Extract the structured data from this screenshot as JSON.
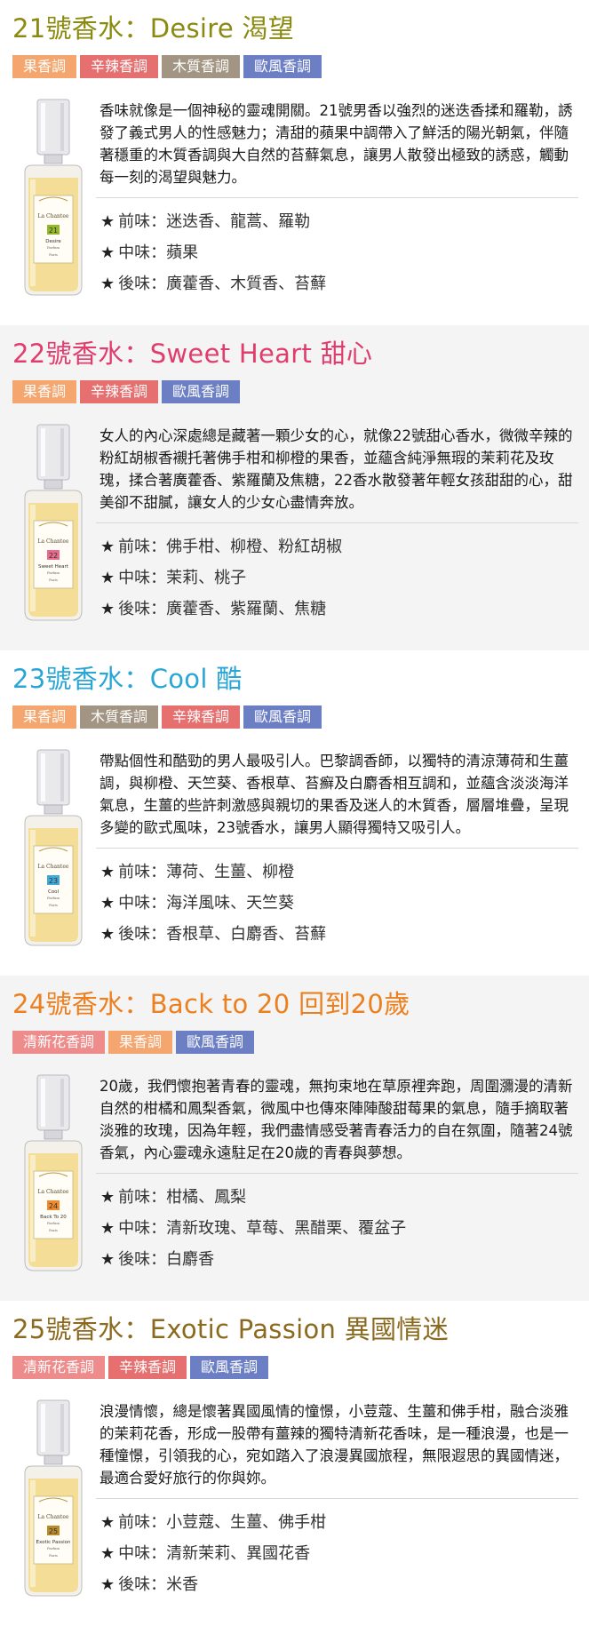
{
  "colors": {
    "fruit": "#f5a66f",
    "spicy": "#e66f6f",
    "woody": "#a39583",
    "oriental": "#6c7fc4",
    "floral": "#ee8c8c"
  },
  "perfumes": [
    {
      "title": "21號香水：Desire 渴望",
      "title_color": "#8b8a10",
      "tags": [
        {
          "label": "果香調",
          "color": "#f5a66f"
        },
        {
          "label": "辛辣香調",
          "color": "#e66f6f"
        },
        {
          "label": "木質香調",
          "color": "#a39583"
        },
        {
          "label": "歐風香調",
          "color": "#6c7fc4"
        }
      ],
      "bottle": {
        "brand": "La Chantee",
        "number": "21",
        "name": "Desire",
        "sub": "Parfum",
        "city": "Paris",
        "num_color": "#93b82a"
      },
      "description": "香味就像是一個神秘的靈魂開關。21號男香以強烈的迷迭香揉和羅勒，誘發了義式男人的性感魅力；清甜的蘋果中調帶入了鮮活的陽光朝氣，伴隨著穩重的木質香調與大自然的苔蘚氣息，讓男人散發出極致的誘惑，觸動每一刻的渴望與魅力。",
      "notes": [
        "前味：迷迭香、龍蒿、羅勒",
        "中味：蘋果",
        "後味：廣藿香、木質香、苔蘚"
      ]
    },
    {
      "title": "22號香水：Sweet Heart 甜心",
      "title_color": "#e03d6e",
      "tags": [
        {
          "label": "果香調",
          "color": "#f5a66f"
        },
        {
          "label": "辛辣香調",
          "color": "#e66f6f"
        },
        {
          "label": "歐風香調",
          "color": "#6c7fc4"
        }
      ],
      "bottle": {
        "brand": "La Chantee",
        "number": "22",
        "name": "Sweet Heart",
        "sub": "Parfum",
        "city": "Paris",
        "num_color": "#e86a8c"
      },
      "description": "女人的內心深處總是藏著一顆少女的心，就像22號甜心香水，微微辛辣的粉紅胡椒香襯托著佛手柑和柳橙的果香，並蘊含純淨無瑕的茉莉花及玫瑰，揉合著廣藿香、紫羅蘭及焦糖，22香水散發著年輕女孩甜甜的心，甜美卻不甜膩，讓女人的少女心盡情奔放。",
      "notes": [
        "前味：佛手柑、柳橙、粉紅胡椒",
        "中味：茉莉、桃子",
        "後味：廣藿香、紫羅蘭、焦糖"
      ]
    },
    {
      "title": "23號香水：Cool 酷",
      "title_color": "#2aa6d6",
      "tags": [
        {
          "label": "果香調",
          "color": "#f5a66f"
        },
        {
          "label": "木質香調",
          "color": "#a39583"
        },
        {
          "label": "辛辣香調",
          "color": "#e66f6f"
        },
        {
          "label": "歐風香調",
          "color": "#6c7fc4"
        }
      ],
      "bottle": {
        "brand": "La Chantee",
        "number": "23",
        "name": "Cool",
        "sub": "Parfum",
        "city": "Paris",
        "num_color": "#3fa9d8"
      },
      "description": "帶點個性和酷勁的男人最吸引人。巴黎調香師，以獨特的清涼薄荷和生薑調，與柳橙、天竺葵、香根草、苔癬及白麝香相互調和，並蘊含淡淡海洋氣息，生薑的些許刺激感與親切的果香及迷人的木質香，層層堆疊，呈現多變的歐式風味，23號香水，讓男人顯得獨特又吸引人。",
      "notes": [
        "前味：薄荷、生薑、柳橙",
        "中味：海洋風味、天竺葵",
        "後味：香根草、白麝香、苔蘚"
      ]
    },
    {
      "title": "24號香水：Back to 20 回到20歲",
      "title_color": "#ec7f1e",
      "tags": [
        {
          "label": "清新花香調",
          "color": "#ee8c8c"
        },
        {
          "label": "果香調",
          "color": "#f5a66f"
        },
        {
          "label": "歐風香調",
          "color": "#6c7fc4"
        }
      ],
      "bottle": {
        "brand": "La Chantee",
        "number": "24",
        "name": "Back To 20",
        "sub": "Parfum",
        "city": "Paris",
        "num_color": "#f08a2a"
      },
      "description": "20歲，我們懷抱著青春的靈魂，無拘束地在草原裡奔跑，周圍瀰漫的清新自然的柑橘和鳳梨香氣，微風中也傳來陣陣酸甜莓果的氣息，隨手摘取著淡雅的玫瑰，因為年輕，我們盡情感受著青春活力的自在氛圍，隨著24號香氣，內心靈魂永遠駐足在20歲的青春與夢想。",
      "notes": [
        "前味：柑橘、鳳梨",
        "中味：清新玫瑰、草莓、黑醋栗、覆盆子",
        "後味：白麝香"
      ]
    },
    {
      "title": "25號香水：Exotic Passion 異國情迷",
      "title_color": "#8b6a1f",
      "tags": [
        {
          "label": "清新花香調",
          "color": "#ee8c8c"
        },
        {
          "label": "辛辣香調",
          "color": "#e66f6f"
        },
        {
          "label": "歐風香調",
          "color": "#6c7fc4"
        }
      ],
      "bottle": {
        "brand": "La Chantee",
        "number": "25",
        "name": "Exotic Passion",
        "sub": "Parfum",
        "city": "Paris",
        "num_color": "#b88a2a"
      },
      "description": "浪漫情懷，總是懷著異國風情的憧憬，小荳蔻、生薑和佛手柑，融合淡雅的茉莉花香，形成一股帶有薑辣的獨特清新花香味，是一種浪漫，也是一種憧憬，引領我的心，宛如踏入了浪漫異國旅程，無限遐思的異國情迷，最適合愛好旅行的你與妳。",
      "notes": [
        "前味：小荳蔻、生薑、佛手柑",
        "中味：清新茉莉、異國花香",
        "後味：米香"
      ]
    }
  ]
}
